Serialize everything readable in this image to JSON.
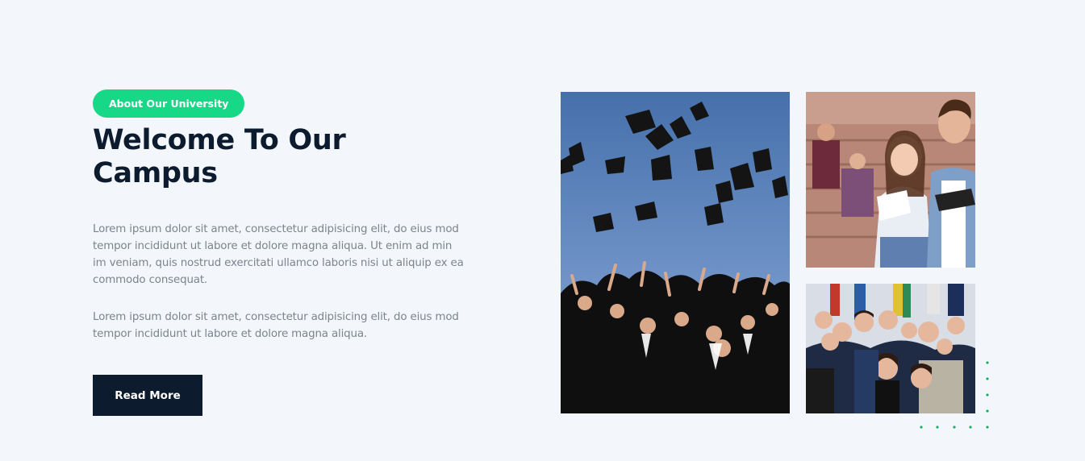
{
  "about": {
    "badge": "About Our University",
    "title": "Welcome To Our Campus",
    "paragraph1": "Lorem ipsum dolor sit amet, consectetur adipisicing elit, do eius mod tempor incididunt ut labore et dolore magna aliqua. Ut enim ad min im veniam, quis nostrud exercitati ullamco laboris nisi ut aliquip ex ea commodo consequat.",
    "paragraph2": "Lorem ipsum dolor sit amet, consectetur adipisicing elit, do eius mod tempor incididunt ut labore et dolore magna aliqua.",
    "button_label": "Read More"
  },
  "colors": {
    "accent": "#17d887",
    "dark": "#0c1b2e",
    "background": "#f3f6fa",
    "body_text": "#7d838d"
  }
}
